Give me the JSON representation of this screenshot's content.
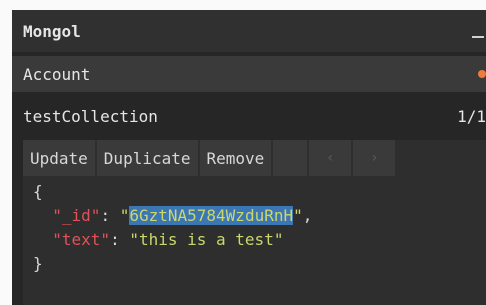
{
  "app": {
    "title": "Mongol"
  },
  "connection": {
    "name": "Account",
    "status_color": "#f07b3a"
  },
  "collection": {
    "name": "testCollection",
    "pager": "1/1"
  },
  "toolbar": {
    "update_label": "Update",
    "duplicate_label": "Duplicate",
    "remove_label": "Remove",
    "prev_label": "‹",
    "next_label": "›"
  },
  "document": {
    "open_brace": "{",
    "close_brace": "}",
    "fields": [
      {
        "key": "\"_id\"",
        "value": "6GztNA5784WzduRnH"
      },
      {
        "key": "\"text\"",
        "value": "\"this is a test\""
      }
    ]
  },
  "colors": {
    "key": "#e0525a",
    "string": "#c9d86b",
    "selection": "#3d76b5",
    "background": "#262626"
  },
  "icons": {
    "minimize": "minimize-icon",
    "status": "status-dot-icon",
    "prev": "chevron-left-icon",
    "next": "chevron-right-icon"
  }
}
